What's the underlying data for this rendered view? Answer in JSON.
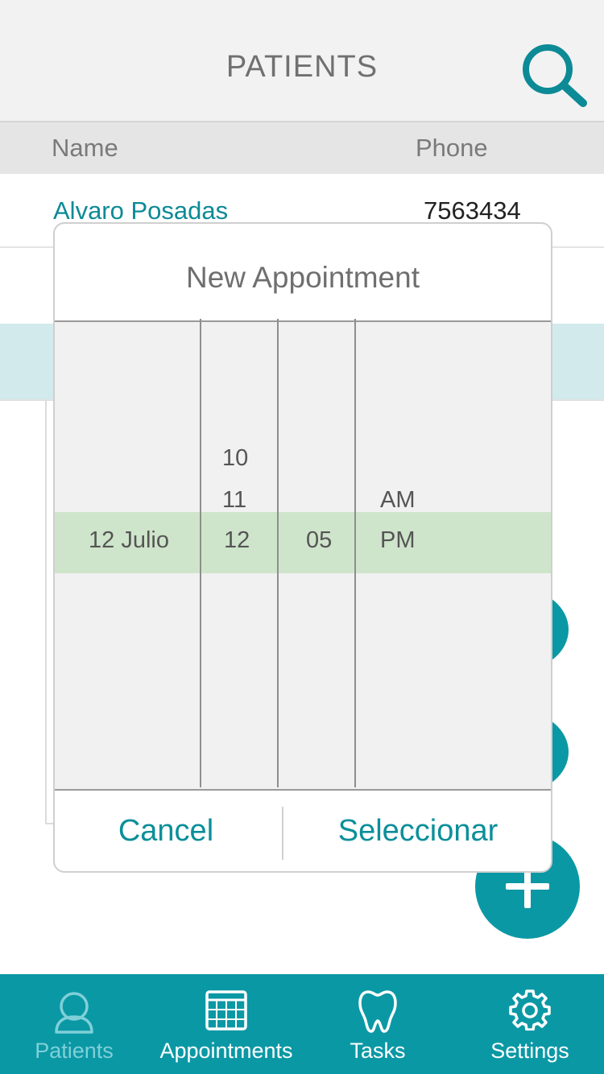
{
  "header": {
    "title": "PATIENTS",
    "search_icon": "search-icon"
  },
  "table": {
    "columns": [
      "Name",
      "Phone"
    ],
    "rows": [
      {
        "name": "Alvaro Posadas",
        "phone": "7563434"
      }
    ]
  },
  "dialog": {
    "title": "New Appointment",
    "picker": {
      "date": {
        "selected": "12 Julio"
      },
      "hour": {
        "above": [
          "10",
          "11"
        ],
        "selected": "12"
      },
      "minute": {
        "selected": "05"
      },
      "period": {
        "above": [
          "AM"
        ],
        "selected": "PM"
      }
    },
    "cancel_label": "Cancel",
    "select_label": "Seleccionar"
  },
  "tabs": [
    {
      "label": "Patients",
      "icon": "person-icon",
      "active": true
    },
    {
      "label": "Appointments",
      "icon": "calendar-icon",
      "active": false
    },
    {
      "label": "Tasks",
      "icon": "tooth-icon",
      "active": false
    },
    {
      "label": "Settings",
      "icon": "gear-icon",
      "active": false
    }
  ],
  "colors": {
    "accent": "#0b98a5",
    "link": "#0c8a96",
    "selection_band": "#cfe5cb",
    "selected_row": "#d2eaec",
    "active_tab": "#7fd0d8"
  }
}
